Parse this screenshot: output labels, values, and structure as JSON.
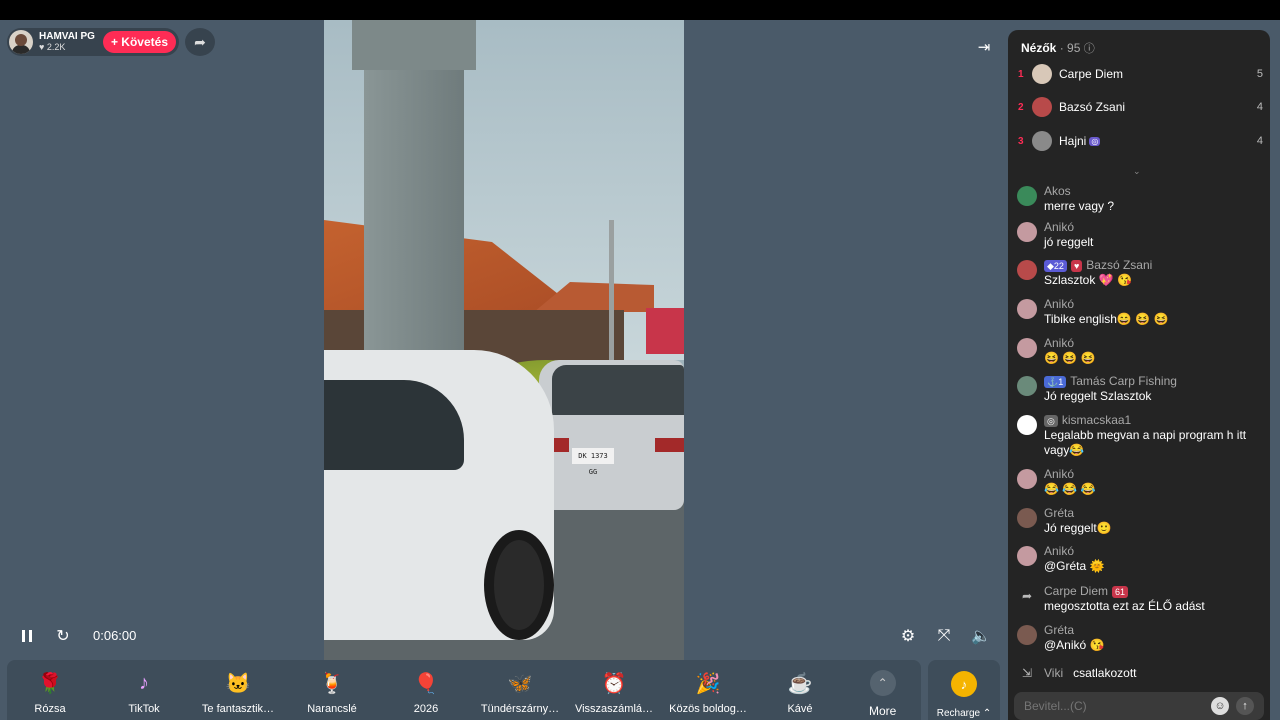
{
  "host": {
    "name": "HAMVAI PG",
    "likes": "♥ 2.2K",
    "follow_label": "+ Követés"
  },
  "player": {
    "time": "0:06:00"
  },
  "video": {
    "plate": "DK 1373 GG"
  },
  "gifts": [
    {
      "label": "Rózsa",
      "icon": "rose-icon",
      "glyph": "🌹"
    },
    {
      "label": "TikTok",
      "icon": "tiktok-icon",
      "glyph": "♪"
    },
    {
      "label": "Te fantasztik…",
      "icon": "cat-icon",
      "glyph": "🐱"
    },
    {
      "label": "Narancslé",
      "icon": "orange-juice-icon",
      "glyph": "🍹"
    },
    {
      "label": "2026",
      "icon": "2026-icon",
      "glyph": "🎈"
    },
    {
      "label": "Tündérszárny…",
      "icon": "fairy-wings-icon",
      "glyph": "🦋"
    },
    {
      "label": "Visszaszámlá…",
      "icon": "countdown-icon",
      "glyph": "⏰"
    },
    {
      "label": "Közös boldog…",
      "icon": "celebration-icon",
      "glyph": "🎉"
    },
    {
      "label": "Kávé",
      "icon": "coffee-icon",
      "glyph": "☕"
    }
  ],
  "more_label": "More",
  "recharge_label": "Recharge ⌃",
  "panel": {
    "title": "Nézők",
    "count": "· 95",
    "viewers": [
      {
        "rank": "1",
        "name": "Carpe Diem",
        "score": "5",
        "color": "#d8c8b8"
      },
      {
        "rank": "2",
        "name": "Bazsó Zsani",
        "score": "4",
        "color": "#b84a4a"
      },
      {
        "rank": "3",
        "name": "Hajni",
        "score": "4",
        "color": "#8a8a8a"
      }
    ],
    "chat": [
      {
        "name": "Ákos",
        "text": "merre vagy ?",
        "color": "#3a8a5a"
      },
      {
        "name": "Anikó",
        "text": "jó reggelt",
        "color": "#c49aa0"
      },
      {
        "name": "Bazsó Zsani",
        "badge": "◆22",
        "text": "Szlasztok 💖 😘",
        "color": "#b84a4a"
      },
      {
        "name": "Anikó",
        "text": "Tibike english😄 😆 😆",
        "color": "#c49aa0"
      },
      {
        "name": "Anikó",
        "text": "😆 😆 😆",
        "color": "#c49aa0"
      },
      {
        "name": "Tamás Carp Fishing",
        "badge": "⚓1",
        "text": "Jó reggelt Szlasztok",
        "color": "#6a8a7a"
      },
      {
        "name": "kismacskaa1",
        "text": "Legalabb megvan a napi program h itt vagy😂",
        "color": "#ffffff"
      },
      {
        "name": "Anikó",
        "text": "😂 😂 😂",
        "color": "#c49aa0"
      },
      {
        "name": "Gréta",
        "text": "Jó reggelt🙂",
        "color": "#7a5a50"
      },
      {
        "name": "Anikó",
        "text": "@Gréta 🌞",
        "color": "#c49aa0"
      },
      {
        "name": "Carpe Diem",
        "badge": "61",
        "text": "megosztotta ezt az ÉLŐ adást",
        "color": "#242424"
      },
      {
        "name": "Gréta",
        "text": "@Anikó 😘",
        "color": "#7a5a50"
      },
      {
        "name": "Viki",
        "text": "csatlakozott",
        "color": "#242424"
      }
    ],
    "input_placeholder": "Bevitel...(C)"
  }
}
